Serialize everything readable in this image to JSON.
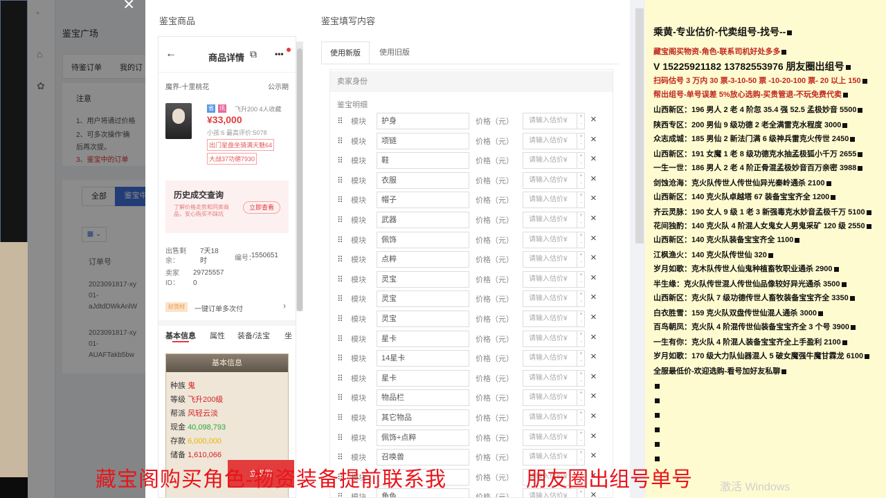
{
  "background": {
    "plaza_title": "鉴宝广场",
    "tabs": [
      "待鉴订单",
      "我的订"
    ],
    "notice_title": "注意",
    "notices": [
      "1、用户将通过价格",
      "2、可多次操作'确",
      "后再次提。",
      "3、鉴宝中的订单"
    ],
    "filters": [
      "全部",
      "鉴宝中"
    ],
    "table_header": "订单号",
    "rows": [
      {
        "id": "2023091817-xy",
        "sub": "01-",
        "code": "aJdtdDWkAnlW"
      },
      {
        "id": "2023091817-xy",
        "sub": "01-",
        "code": "AUAFTakb5bw"
      }
    ]
  },
  "modal": {
    "close_icon": "×",
    "left_title": "鉴宝商品",
    "right_title": "鉴宝填写内容"
  },
  "phone": {
    "header_title": "商品详情",
    "back_icon": "←",
    "share_icon": "⧉",
    "more_icon": "•••",
    "server": "魔界-十里桃花",
    "public": "公示期",
    "badges": [
      "省",
      "讯"
    ],
    "fav": "飞升200 4人收藏",
    "price": "¥33,000",
    "meta": "小孩:6 最高评价:5078",
    "tag1": "出门星盘坐骑满天魅64",
    "tag2": "大战37功德7930",
    "history_title": "历史成交查询",
    "history_desc": "了解价格走势和同类商品，安心购买不踩坑",
    "history_btn": "立即查看",
    "remain_label": "出售剩余：",
    "remain_value": "7天18时",
    "id_label": "编号：",
    "id_value": "1550651",
    "seller_label": "卖家ID：",
    "seller_value": "29725557",
    "zero": "0",
    "recommend_badge": "好货村",
    "recommend_text": "一键订单多次付",
    "tabs": [
      "基本信息",
      "属性",
      "装备/法宝",
      "坐"
    ],
    "card_title": "基本信息",
    "info": [
      {
        "label": "种族",
        "value": "鬼",
        "color": "#d62020"
      },
      {
        "label": "等级",
        "value": "飞升200级",
        "color": "#d62020"
      },
      {
        "label": "帮派",
        "value": "风轻云淡",
        "color": "#d62020"
      },
      {
        "label": "现金",
        "value": "40,098,793",
        "color": "#2aa83c"
      },
      {
        "label": "存款",
        "value": "6,000,000",
        "color": "#e8b400"
      },
      {
        "label": "储备",
        "value": "1,610,066",
        "color": "#d62020"
      }
    ],
    "buy_btn": "立即购"
  },
  "form": {
    "tabs": [
      "使用新版",
      "使用旧版"
    ],
    "seller_section": "卖家身份",
    "detail_section": "鉴宝明细",
    "module_label": "模块",
    "price_label": "价格（元）",
    "price_placeholder": "请输入估价¥",
    "modules": [
      "护身",
      "项链",
      "鞋",
      "衣服",
      "帽子",
      "武器",
      "佩饰",
      "点粹",
      "灵宝",
      "灵宝",
      "灵宝",
      "星卡",
      "14星卡",
      "星卡",
      "物品栏",
      "其它物品",
      "佩饰+点粹",
      "召唤兽",
      "",
      "角色"
    ],
    "remove_icon": "×",
    "drag_icon": "⠿"
  },
  "right_panel": {
    "lines": [
      {
        "text": "乘黄-专业估价-代卖组号-找号--",
        "style": "lg",
        "sq": true
      },
      {
        "text": "藏宝阁买物资-角色-联系司机好处多多",
        "style": "red",
        "sq": true
      },
      {
        "text": "V 15225921182   13782553976 朋友圈出组号",
        "style": "lg",
        "sq": true
      },
      {
        "text": "扫码估号 3 万内 30 票-3-10-50 票 -10-20-100 票- 20 以上 150",
        "style": "red",
        "sq": true
      },
      {
        "text": "帮出组号-单号误差 5%放心选购-买贵管退-不玩免费代卖",
        "style": "red",
        "sq": true
      },
      {
        "text": "山西新区：196 男人 2 老 4 阶忽 35.4 强 52.5 孟极妙音 5500",
        "style": "",
        "sq": true
      },
      {
        "text": "陕西专区：200 男仙 9 级功德 2 老全满雷克水程度 3000",
        "style": "",
        "sq": true
      },
      {
        "text": "众志成城：185 男仙 2 新法门满 6 级神兵雷克火传世 2450",
        "style": "",
        "sq": true
      },
      {
        "text": "山西新区：191 女魔 1 老 8 级功德克水抽孟极狐小千万 2655",
        "style": "",
        "sq": true
      },
      {
        "text": "一生一世：186 男人 2 老 4 阶正骨混孟极妙音百万亲密 3988",
        "style": "",
        "sq": true
      },
      {
        "text": "剑蚀沧海：克火队传世人传世仙异光秦岭通杀 2100",
        "style": "",
        "sq": true
      },
      {
        "text": "山西新区：140 克火队卓越塔 67 装备宝宝齐全 1200",
        "style": "",
        "sq": true
      },
      {
        "text": "齐云灵脉：190 女人 9 级 1 老 3 新强毒克水妙音孟极千万 5100",
        "style": "",
        "sq": true
      },
      {
        "text": "花间独酌：140 克火队 4 阶混人女鬼女人男鬼采矿 120 级 2550",
        "style": "",
        "sq": true
      },
      {
        "text": "山西新区：140 克火队装备宝宝齐全 1100",
        "style": "",
        "sq": true
      },
      {
        "text": "江枫渔火：140 克火队传世仙 320",
        "style": "",
        "sq": true
      },
      {
        "text": "岁月如歌：克木队传世人仙鬼种植畜牧职业通杀 2900",
        "style": "",
        "sq": true
      },
      {
        "text": "半生缘：克火队传世混人传世仙品像较好异光通杀 3500",
        "style": "",
        "sq": true
      },
      {
        "text": "山西新区：克火队 7 级功德传世人畜牧装备宝宝齐全 3350",
        "style": "",
        "sq": true
      },
      {
        "text": "白衣胜雪：159 克火队双盘传世仙混人通杀 3000",
        "style": "",
        "sq": true
      },
      {
        "text": "百鸟朝凤：克火队 4 阶混传世仙装备宝宝齐全 3 个号 3900",
        "style": "",
        "sq": true
      },
      {
        "text": "一生有你：克火队 4 阶混人装备宝宝齐全上手盈利 2100",
        "style": "",
        "sq": true
      },
      {
        "text": "岁月如歌：170 级大力队仙器混人 5 破女魔强牛魔甘霖龙 6100",
        "style": "",
        "sq": true
      },
      {
        "text": "全服最低价-欢迎选购-看号加好友私聊",
        "style": "",
        "sq": true
      }
    ],
    "trailing_squares": 6
  },
  "caption": {
    "left": "藏宝阁购买角色-物资装备提前联系我",
    "right": "朋友圈出组号单号"
  },
  "watermark": "激活 Windows"
}
